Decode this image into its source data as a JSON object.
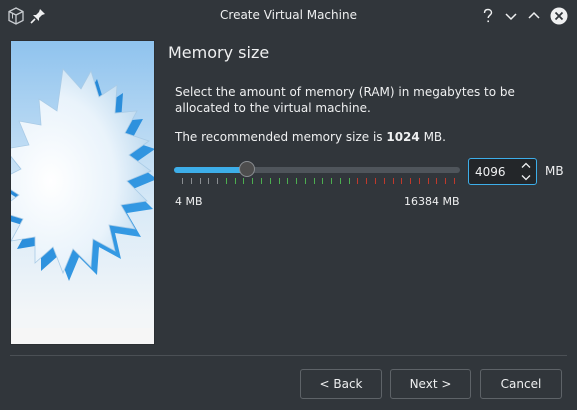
{
  "window": {
    "title": "Create Virtual Machine",
    "app_icon": "virtualbox-cube-icon",
    "pin_icon": "pin-icon",
    "controls": [
      "help-icon",
      "minimize-icon",
      "maximize-icon",
      "close-icon"
    ]
  },
  "page": {
    "title": "Memory size",
    "description": "Select the amount of memory (RAM) in megabytes to be allocated to the virtual machine.",
    "recommend_prefix": "The recommended memory size is ",
    "recommend_value": "1024",
    "recommend_suffix": " MB."
  },
  "memory": {
    "min_label": "4 MB",
    "max_label": "16384 MB",
    "min_mb": 4,
    "max_mb": 16384,
    "value_mb": 4096,
    "value_text": "4096",
    "unit": "MB"
  },
  "buttons": {
    "back": "< Back",
    "next": "Next >",
    "cancel": "Cancel"
  },
  "colors": {
    "accent": "#3daee9",
    "background": "#31363b",
    "text": "#eff0f1",
    "tick_green": "#4caf50",
    "tick_red": "#c0392b",
    "tick_neutral": "#8a8e92"
  }
}
